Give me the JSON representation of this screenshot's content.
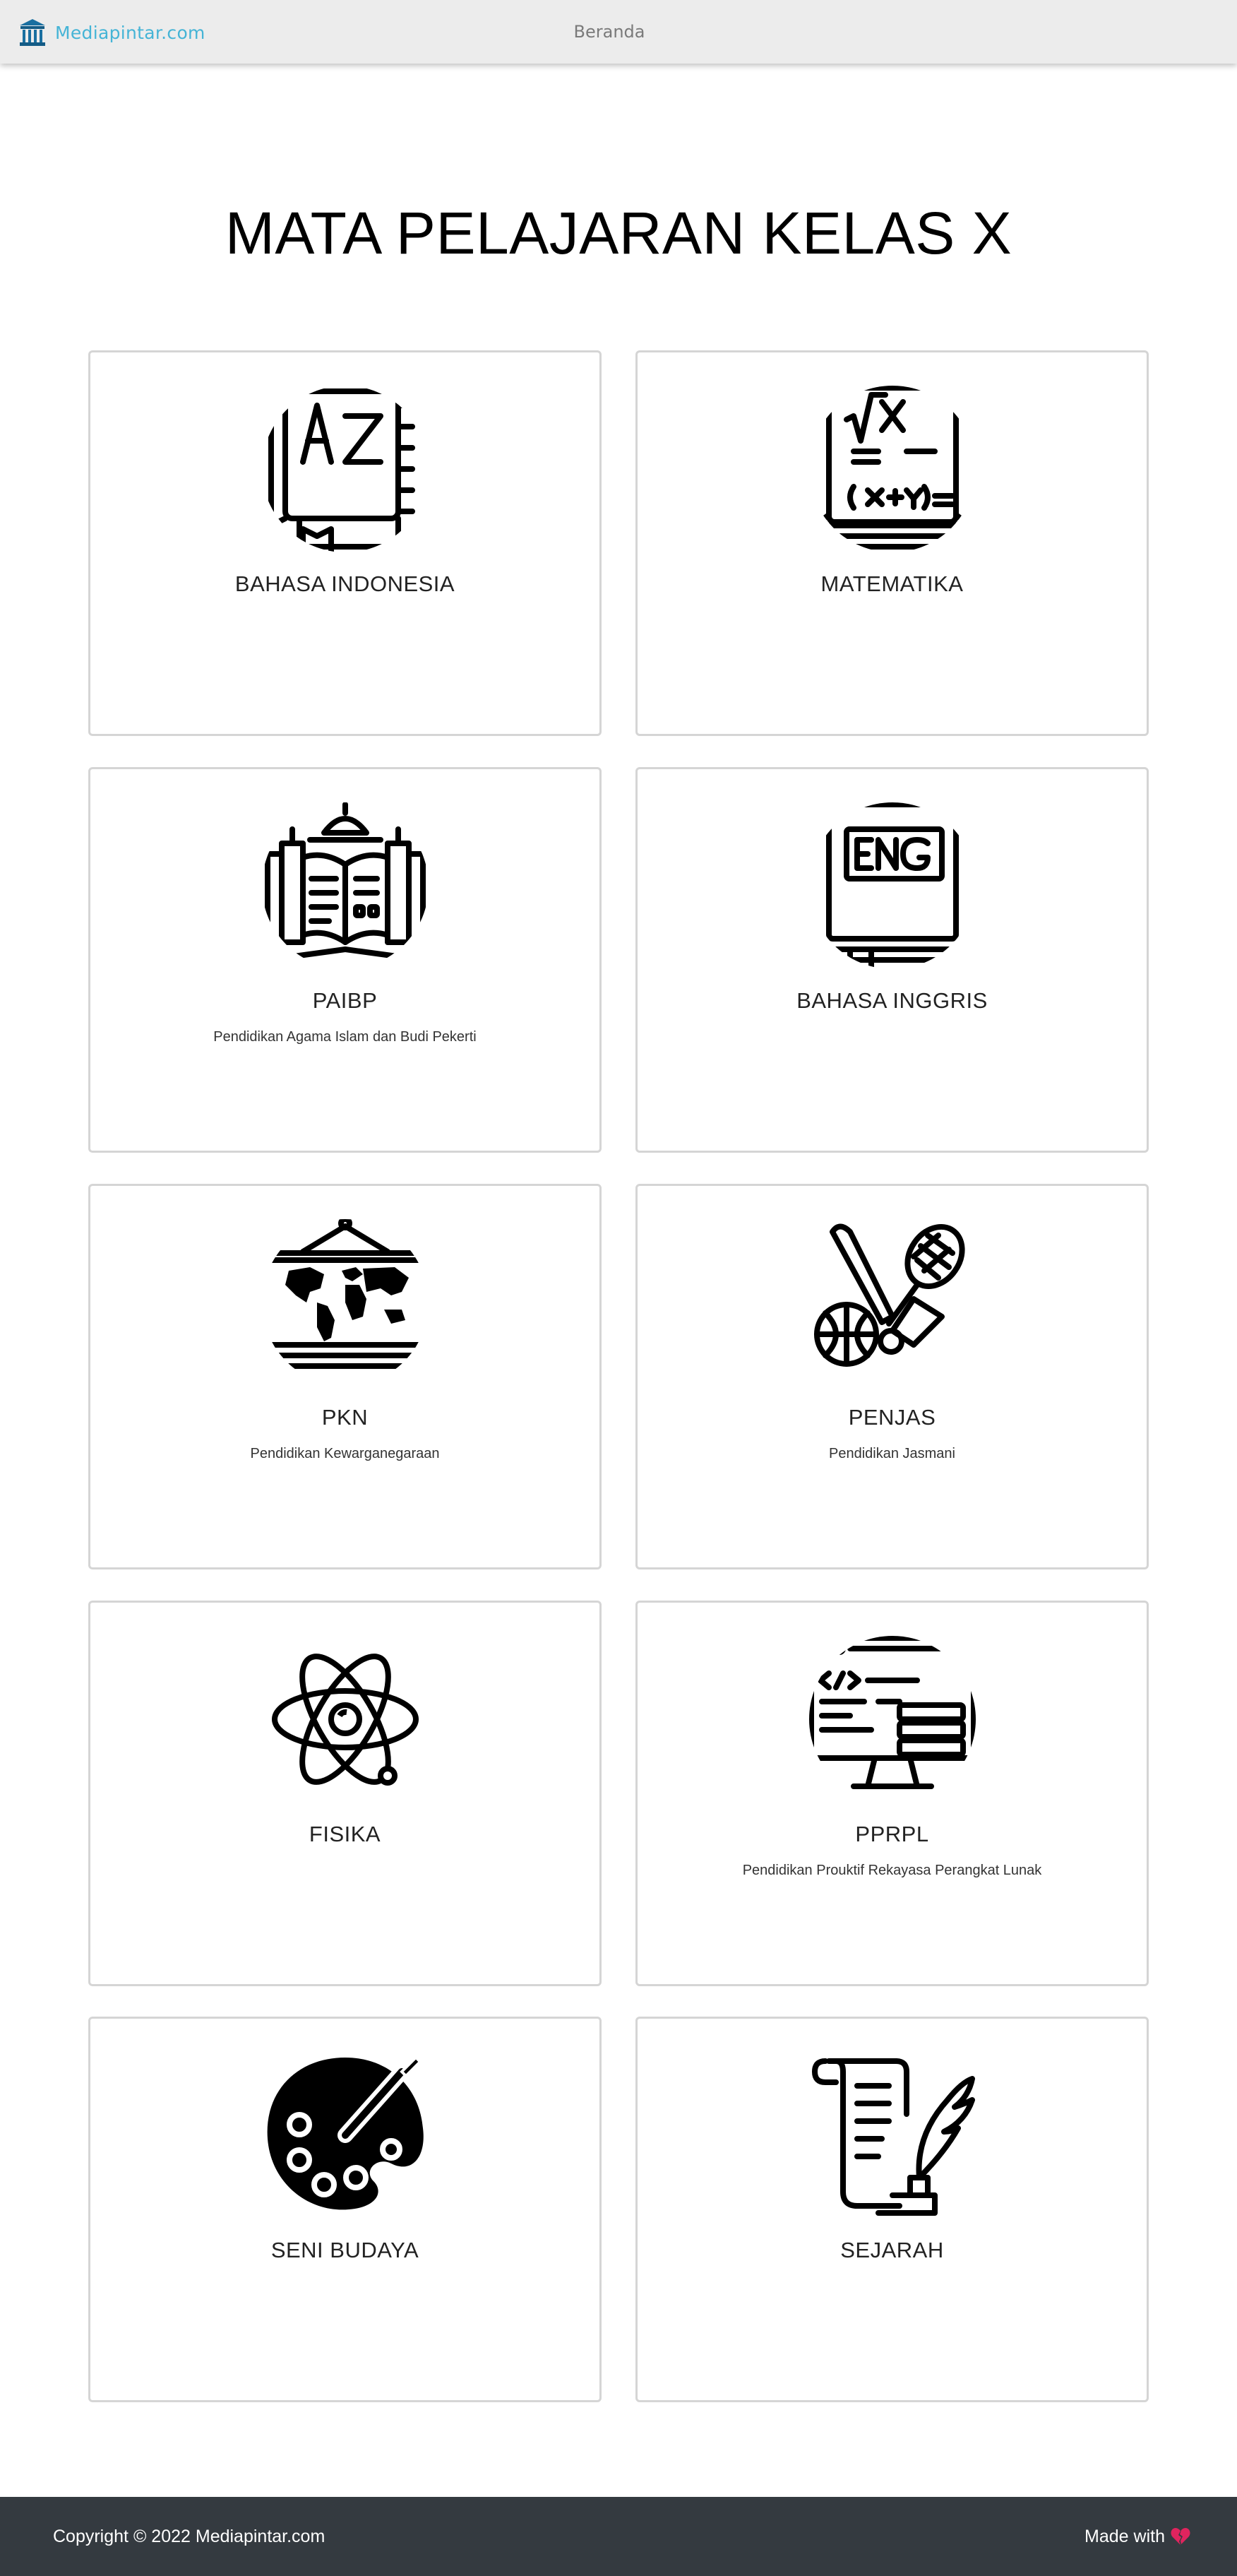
{
  "navbar": {
    "brand_text": "Mediapintar.com",
    "brand_icon": "school-building-icon",
    "nav_link": "Beranda"
  },
  "page_title": "MATA PELAJARAN KELAS X",
  "subjects": [
    {
      "name": "BAHASA INDONESIA",
      "desc": "",
      "icon": "az-book-icon"
    },
    {
      "name": "MATEMATIKA",
      "desc": "",
      "icon": "math-book-icon"
    },
    {
      "name": "PAIBP",
      "desc": "Pendidikan Agama Islam dan Budi Pekerti",
      "icon": "mosque-book-icon"
    },
    {
      "name": "BAHASA INGGRIS",
      "desc": "",
      "icon": "eng-book-icon"
    },
    {
      "name": "PKN",
      "desc": "Pendidikan Kewarganegaraan",
      "icon": "world-map-icon"
    },
    {
      "name": "PENJAS",
      "desc": "Pendidikan Jasmani",
      "icon": "sports-equipment-icon"
    },
    {
      "name": "FISIKA",
      "desc": "",
      "icon": "atom-icon"
    },
    {
      "name": "PPRPL",
      "desc": "Pendidikan Prouktif Rekayasa Perangkat Lunak",
      "icon": "code-monitor-icon"
    },
    {
      "name": "SENI BUDAYA",
      "desc": "",
      "icon": "paint-palette-icon"
    },
    {
      "name": "SEJARAH",
      "desc": "",
      "icon": "scroll-quill-icon"
    }
  ],
  "footer": {
    "copyright": "Copyright © 2022 Mediapintar.com",
    "made_with": "Made with",
    "made_with_icon": "broken-heart-icon",
    "heart_color": "#e0245e"
  },
  "colors": {
    "navbar_bg": "#ececec",
    "brand": "#45b4d6",
    "footer_bg": "#343a40",
    "card_border": "#d5d5d5"
  }
}
